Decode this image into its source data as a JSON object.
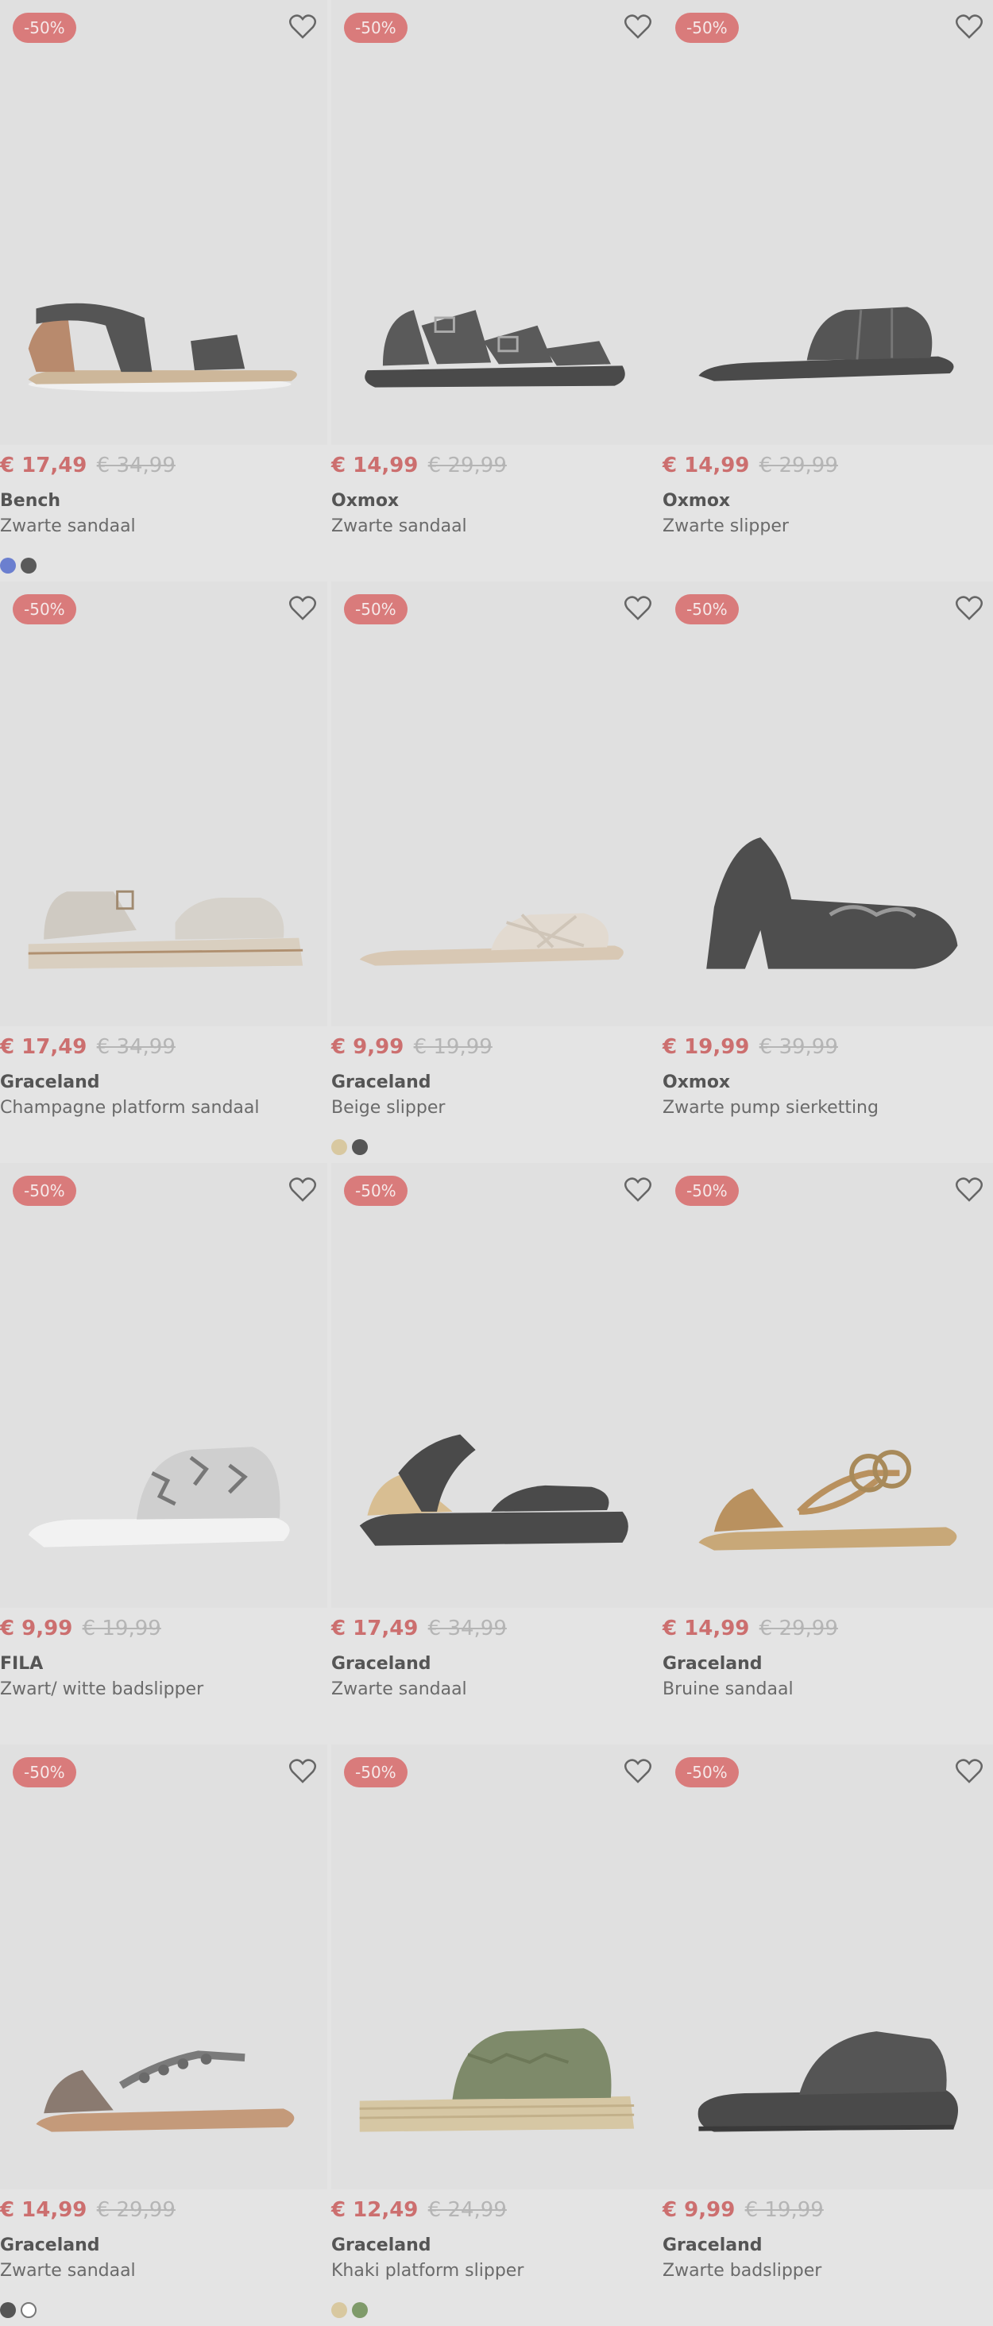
{
  "products": [
    {
      "discount": "-50%",
      "sale_price": "€ 17,49",
      "orig_price": "€ 34,99",
      "brand": "Bench",
      "name": "Zwarte sandaal",
      "shoe": "sandal-elastic-icon",
      "swatches": [
        "#6b7fcf",
        "#5a5a5a"
      ]
    },
    {
      "discount": "-50%",
      "sale_price": "€ 14,99",
      "orig_price": "€ 29,99",
      "brand": "Oxmox",
      "name": "Zwarte sandaal",
      "shoe": "sandal-buckle-icon",
      "swatches": []
    },
    {
      "discount": "-50%",
      "sale_price": "€ 14,99",
      "orig_price": "€ 29,99",
      "brand": "Oxmox",
      "name": "Zwarte slipper",
      "shoe": "slipper-padded-icon",
      "swatches": []
    },
    {
      "discount": "-50%",
      "sale_price": "€ 17,49",
      "orig_price": "€ 34,99",
      "brand": "Graceland",
      "name": "Champagne platform sandaal",
      "shoe": "platform-sandal-icon",
      "swatches": []
    },
    {
      "discount": "-50%",
      "sale_price": "€ 9,99",
      "orig_price": "€ 19,99",
      "brand": "Graceland",
      "name": "Beige slipper",
      "shoe": "slipper-woven-icon",
      "swatches": [
        "#d8c8a0",
        "#555555"
      ]
    },
    {
      "discount": "-50%",
      "sale_price": "€ 19,99",
      "orig_price": "€ 39,99",
      "brand": "Oxmox",
      "name": "Zwarte pump sierketting",
      "shoe": "pump-loafer-icon",
      "swatches": []
    },
    {
      "discount": "-50%",
      "sale_price": "€ 9,99",
      "orig_price": "€ 19,99",
      "brand": "FILA",
      "name": "Zwart/ witte badslipper",
      "shoe": "badslipper-snake-icon",
      "swatches": []
    },
    {
      "discount": "-50%",
      "sale_price": "€ 17,49",
      "orig_price": "€ 34,99",
      "brand": "Graceland",
      "name": "Zwarte sandaal",
      "shoe": "sandal-wedge-icon",
      "swatches": []
    },
    {
      "discount": "-50%",
      "sale_price": "€ 14,99",
      "orig_price": "€ 29,99",
      "brand": "Graceland",
      "name": "Bruine sandaal",
      "shoe": "sandal-thong-chain-icon",
      "swatches": []
    },
    {
      "discount": "-50%",
      "sale_price": "€ 14,99",
      "orig_price": "€ 29,99",
      "brand": "Graceland",
      "name": "Zwarte sandaal",
      "shoe": "sandal-thong-jewel-icon",
      "swatches": [
        "#555555",
        "#ffffff"
      ]
    },
    {
      "discount": "-50%",
      "sale_price": "€ 12,49",
      "orig_price": "€ 24,99",
      "brand": "Graceland",
      "name": "Khaki platform slipper",
      "shoe": "espadrille-slipper-icon",
      "swatches": [
        "#d8c8a0",
        "#7f9a6a"
      ]
    },
    {
      "discount": "-50%",
      "sale_price": "€ 9,99",
      "orig_price": "€ 19,99",
      "brand": "Graceland",
      "name": "Zwarte badslipper",
      "shoe": "badslipper-chunky-icon",
      "swatches": []
    }
  ],
  "colors": {
    "sale": "#cc6f6f",
    "badge": "#d97b7b",
    "background": "#e4e4e4"
  }
}
